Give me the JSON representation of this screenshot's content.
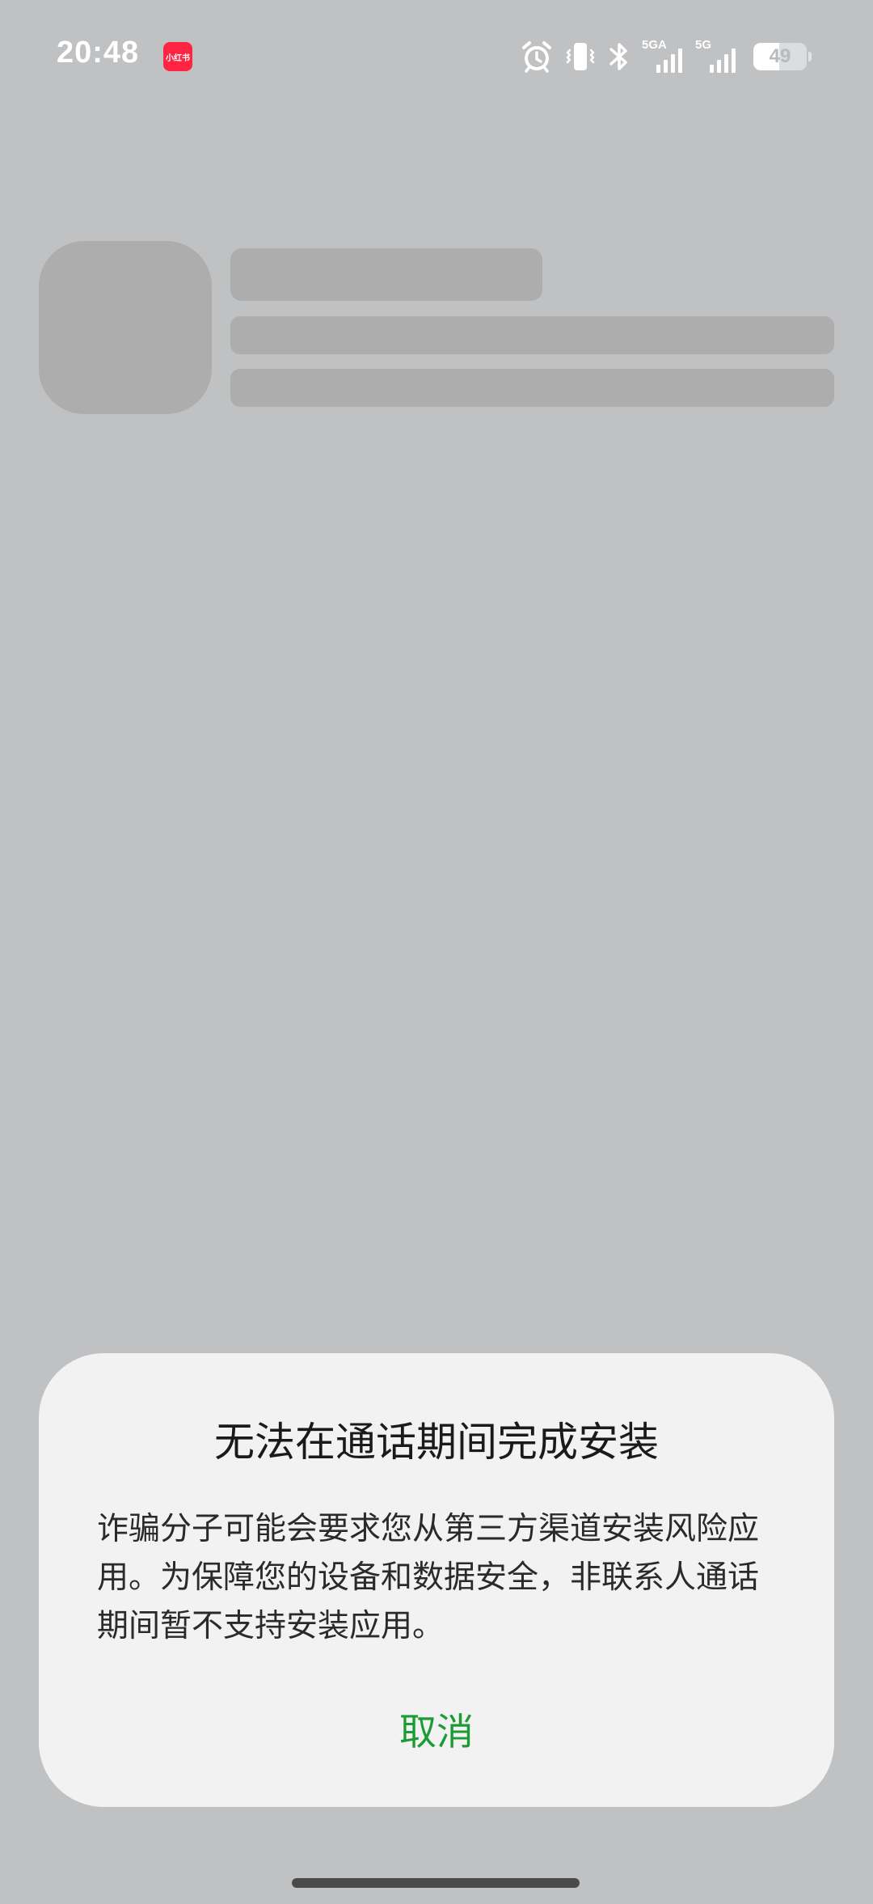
{
  "status_bar": {
    "time": "20:48",
    "app_badge_text": "小红书",
    "signal_1_label": "5GA",
    "signal_2_label": "5G",
    "battery_level": "49",
    "battery_fraction": 0.49,
    "icons": [
      "alarm-icon",
      "vibrate-icon",
      "bluetooth-icon",
      "signal-icon",
      "signal-icon",
      "battery-icon"
    ]
  },
  "dialog": {
    "title": "无法在通话期间完成安装",
    "message": "诈骗分子可能会要求您从第三方渠道安装风险应用。为保障您的设备和数据安全，非联系人通话期间暂不支持安装应用。",
    "cancel_label": "取消"
  },
  "colors": {
    "background": "#c0c1c3",
    "skeleton": "#adadae",
    "dialog_background": "#f2f2f2",
    "accent": "#1a9b34",
    "app_badge": "#ff2442"
  }
}
